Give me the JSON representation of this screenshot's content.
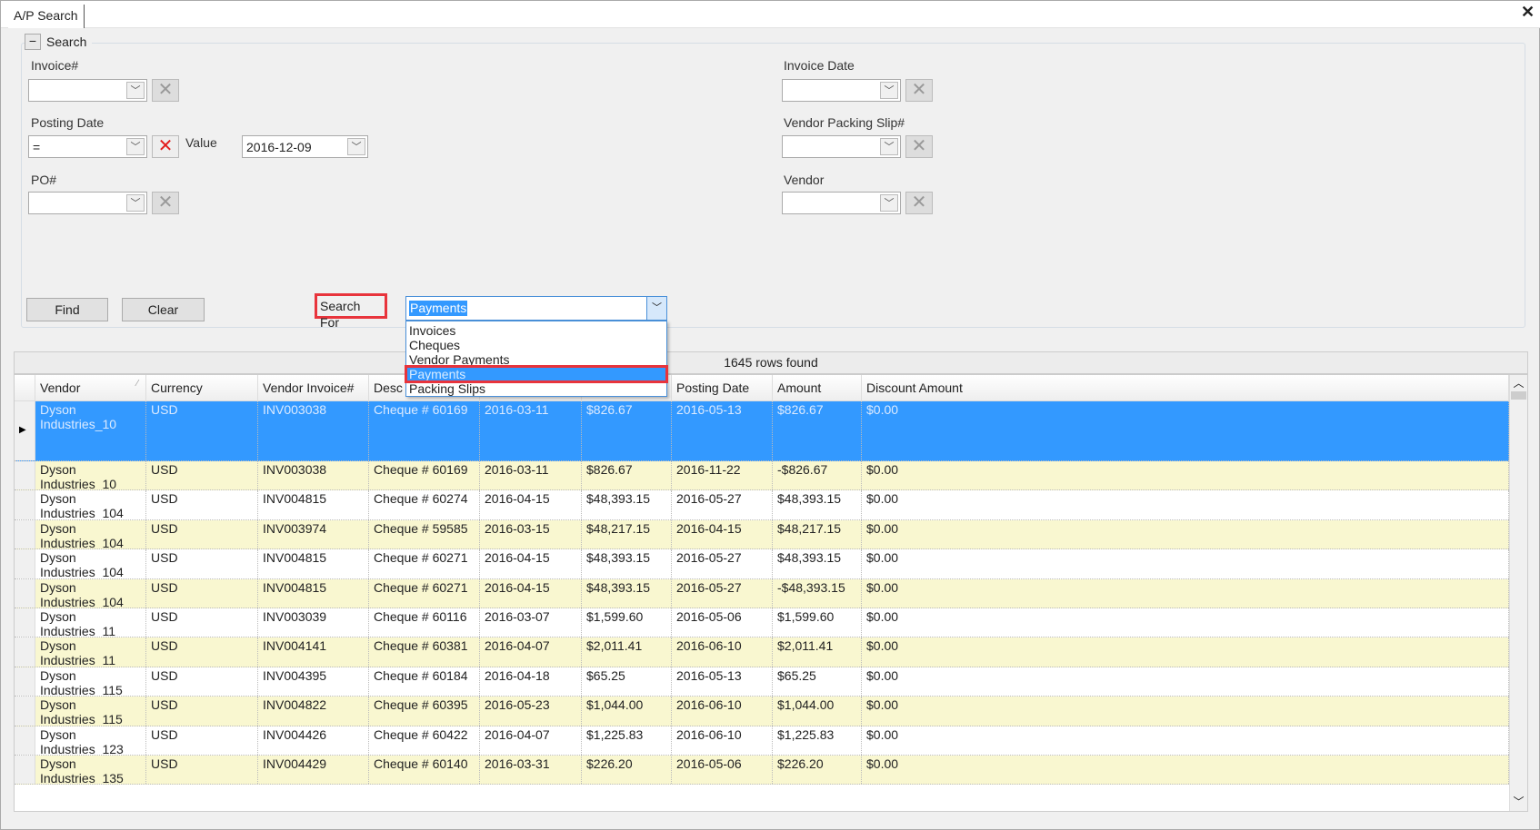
{
  "tab": {
    "title": "A/P Search",
    "close_icon": "close-icon"
  },
  "search_group": {
    "title": "Search",
    "fields": {
      "invoice_no": {
        "label": "Invoice#",
        "value": ""
      },
      "posting_date": {
        "label": "Posting Date",
        "value": "=",
        "value_label": "Value",
        "date_value": "2016-12-09"
      },
      "po_no": {
        "label": "PO#",
        "value": ""
      },
      "invoice_date": {
        "label": "Invoice Date",
        "value": ""
      },
      "vendor_packing_slip": {
        "label": "Vendor Packing Slip#",
        "value": ""
      },
      "vendor": {
        "label": "Vendor",
        "value": ""
      }
    },
    "find_label": "Find",
    "clear_label": "Clear",
    "search_for": {
      "label": "Search For",
      "selected": "Payments",
      "options": [
        "Invoices",
        "Cheques",
        "Vendor Payments",
        "Payments",
        "Packing Slips"
      ]
    }
  },
  "status": "1645 rows found",
  "columns": [
    "Vendor",
    "Currency",
    "Vendor Invoice#",
    "Desc",
    "",
    "",
    "Posting Date",
    "Amount",
    "Discount Amount"
  ],
  "rows": [
    [
      "Dyson Industries_10",
      "USD",
      "INV003038",
      "Cheque # 60169",
      "2016-03-11",
      "$826.67",
      "2016-05-13",
      "$826.67",
      "$0.00"
    ],
    [
      "Dyson Industries_10",
      "USD",
      "INV003038",
      "Cheque # 60169",
      "2016-03-11",
      "$826.67",
      "2016-11-22",
      "-$826.67",
      "$0.00"
    ],
    [
      "Dyson Industries_104",
      "USD",
      "INV004815",
      "Cheque # 60274",
      "2016-04-15",
      "$48,393.15",
      "2016-05-27",
      "$48,393.15",
      "$0.00"
    ],
    [
      "Dyson Industries_104",
      "USD",
      "INV003974",
      "Cheque # 59585",
      "2016-03-15",
      "$48,217.15",
      "2016-04-15",
      "$48,217.15",
      "$0.00"
    ],
    [
      "Dyson Industries_104",
      "USD",
      "INV004815",
      "Cheque # 60271",
      "2016-04-15",
      "$48,393.15",
      "2016-05-27",
      "$48,393.15",
      "$0.00"
    ],
    [
      "Dyson Industries_104",
      "USD",
      "INV004815",
      "Cheque # 60271",
      "2016-04-15",
      "$48,393.15",
      "2016-05-27",
      "-$48,393.15",
      "$0.00"
    ],
    [
      "Dyson Industries_11",
      "USD",
      "INV003039",
      "Cheque # 60116",
      "2016-03-07",
      "$1,599.60",
      "2016-05-06",
      "$1,599.60",
      "$0.00"
    ],
    [
      "Dyson Industries_11",
      "USD",
      "INV004141",
      "Cheque # 60381",
      "2016-04-07",
      "$2,011.41",
      "2016-06-10",
      "$2,011.41",
      "$0.00"
    ],
    [
      "Dyson Industries_115",
      "USD",
      "INV004395",
      "Cheque # 60184",
      "2016-04-18",
      "$65.25",
      "2016-05-13",
      "$65.25",
      "$0.00"
    ],
    [
      "Dyson Industries_115",
      "USD",
      "INV004822",
      "Cheque # 60395",
      "2016-05-23",
      "$1,044.00",
      "2016-06-10",
      "$1,044.00",
      "$0.00"
    ],
    [
      "Dyson Industries_123",
      "USD",
      "INV004426",
      "Cheque # 60422",
      "2016-04-07",
      "$1,225.83",
      "2016-06-10",
      "$1,225.83",
      "$0.00"
    ],
    [
      "Dyson Industries_135",
      "USD",
      "INV004429",
      "Cheque # 60140",
      "2016-03-31",
      "$226.20",
      "2016-05-06",
      "$226.20",
      "$0.00"
    ]
  ],
  "colors": {
    "selection": "#3399ff",
    "alt_row": "#f9f7d0",
    "highlight_box": "#e8343c"
  }
}
